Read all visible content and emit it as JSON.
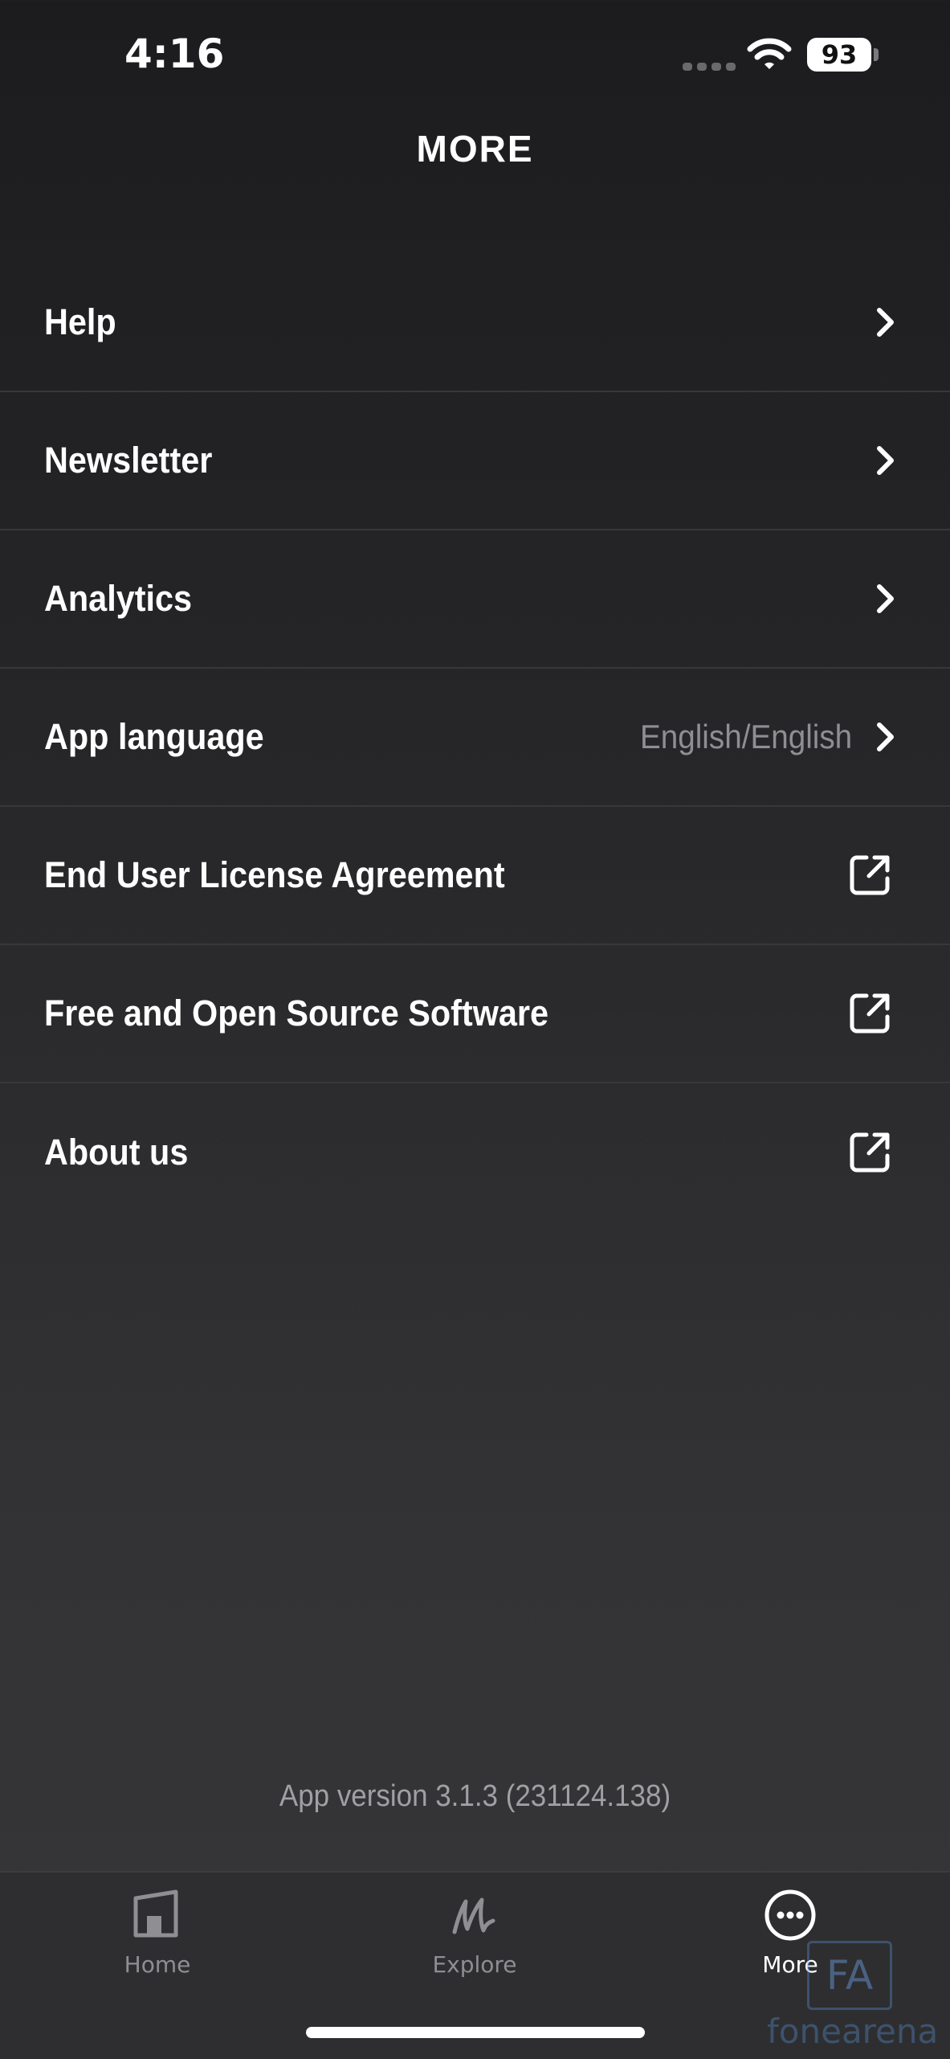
{
  "status_bar": {
    "time": "4:16",
    "battery": "93"
  },
  "header": {
    "title": "MORE"
  },
  "menu": [
    {
      "label": "Help",
      "value": "",
      "icon": "chevron-right-icon"
    },
    {
      "label": "Newsletter",
      "value": "",
      "icon": "chevron-right-icon"
    },
    {
      "label": "Analytics",
      "value": "",
      "icon": "chevron-right-icon"
    },
    {
      "label": "App language",
      "value": "English/English",
      "icon": "chevron-right-icon"
    },
    {
      "label": "End User License Agreement",
      "value": "",
      "icon": "external-link-icon"
    },
    {
      "label": "Free and Open Source Software",
      "value": "",
      "icon": "external-link-icon"
    },
    {
      "label": "About us",
      "value": "",
      "icon": "external-link-icon"
    }
  ],
  "footer": {
    "version": "App version 3.1.3 (231124.138)"
  },
  "tab_bar": {
    "tabs": [
      {
        "label": "Home",
        "icon": "home-icon",
        "active": false
      },
      {
        "label": "Explore",
        "icon": "marshall-m-icon",
        "active": false
      },
      {
        "label": "More",
        "icon": "more-icon",
        "active": true
      }
    ]
  },
  "watermark": {
    "text": "fonearena",
    "box": "FA"
  },
  "colors": {
    "accent": "#ffffff",
    "secondary_text": "#8e8e93",
    "divider": "#38383a"
  }
}
